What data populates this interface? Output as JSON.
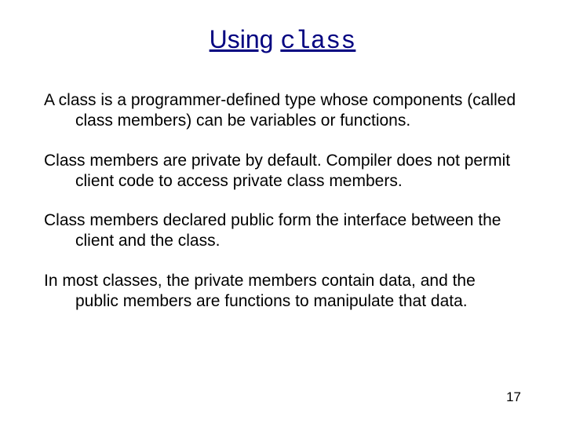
{
  "title": {
    "word1": "Using",
    "word2": "class"
  },
  "paragraphs": {
    "p0": "A class is a programmer-defined type whose components (called class members) can be variables or functions.",
    "p1": "Class members are private by default.  Compiler does not permit client code to access private class members.",
    "p2": "Class members declared public form the interface between the client and the class.",
    "p3": "In most classes, the private members contain data, and the public members are functions to manipulate that data."
  },
  "page_number": "17"
}
